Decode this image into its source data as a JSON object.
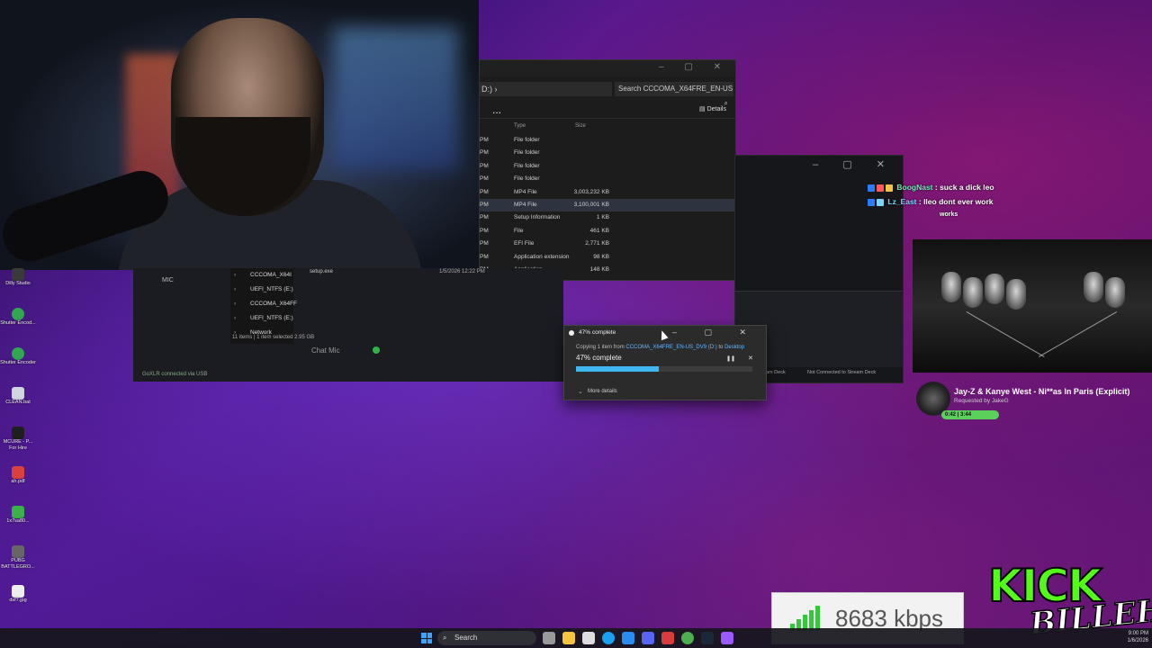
{
  "explorer": {
    "address_suffix": "D:)",
    "search_placeholder": "Search CCCOMA_X64FRE_EN-US",
    "more_glyph": "...",
    "details_label": "Details",
    "columns": {
      "type": "Type",
      "size": "Size"
    },
    "rows": [
      {
        "pm": "PM",
        "type": "File folder",
        "size": ""
      },
      {
        "pm": "PM",
        "type": "File folder",
        "size": ""
      },
      {
        "pm": "PM",
        "type": "File folder",
        "size": ""
      },
      {
        "pm": "PM",
        "type": "File folder",
        "size": ""
      },
      {
        "pm": "PM",
        "type": "MP4 File",
        "size": "3,003,232 KB"
      },
      {
        "pm": "PM",
        "type": "MP4 File",
        "size": "3,100,001 KB"
      },
      {
        "pm": "PM",
        "type": "Setup Information",
        "size": "1 KB"
      },
      {
        "pm": "PM",
        "type": "File",
        "size": "461 KB"
      },
      {
        "pm": "PM",
        "type": "EFI File",
        "size": "2,771 KB"
      },
      {
        "pm": "PM",
        "type": "Application extension",
        "size": "98 KB"
      },
      {
        "pm": "PM",
        "type": "Application",
        "size": "148 KB"
      }
    ]
  },
  "obs": {
    "mic_label": "MIC",
    "tree": [
      {
        "label": "CCCOMA_X64I"
      },
      {
        "label": "UEFI_NTFS (E:)"
      },
      {
        "label": "CCCOMA_X64FF"
      },
      {
        "label": "UEFI_NTFS (E:)"
      },
      {
        "label": "Network"
      }
    ],
    "setup_file": "setup.exe",
    "date": "1/5/2026 12:22 PM",
    "status": "11 items  |  1 item selected  2.95 GB",
    "chat_mic": "Chat Mic",
    "goxlr": "GoXLR connected via USB"
  },
  "streamdeck": {
    "deck_label": "am Deck",
    "status": "Not Connected to Stream Deck"
  },
  "copy_dialog": {
    "title": "47% complete",
    "copying_prefix": "Copying 1 item from ",
    "source": "CCCOMA_X64FRE_EN-US_DV9 (D:)",
    "to": " to ",
    "dest": "Desktop",
    "percent_text": "47% complete",
    "progress": 0.47,
    "more_details": "More details",
    "pause_glyph": "❚❚",
    "cancel_glyph": "✕"
  },
  "chat": {
    "messages": [
      {
        "user": "BoogNast",
        "text": "suck a dick leo",
        "color": "#6ee7b7"
      },
      {
        "user": "Lz_East",
        "text": "lleo dont ever work",
        "color": "#7dd3fc"
      }
    ],
    "overflow_text": "works"
  },
  "now_playing": {
    "song": "Jay-Z & Kanye West - Ni**as In Paris (Explicit)",
    "requested_by": "Requested by JakeG",
    "pill": "0:42  |  3:44"
  },
  "desktop_icons": [
    {
      "label": "Dilly Studio",
      "color": "#3a3a3a"
    },
    {
      "label": "Shutter Encod...",
      "color": "#2fa84f"
    },
    {
      "label": "Shutter Encoder",
      "color": "#2fa84f"
    },
    {
      "label": "CLEAN.bat",
      "color": "#cfd6e0"
    },
    {
      "label": "MCURE - P... For Hire",
      "color": "#1f1f1f"
    },
    {
      "label": "ah.pdf",
      "color": "#d94141"
    },
    {
      "label": "1x7sa80...",
      "color": "#3cb04a"
    },
    {
      "label": "PUBG BATTLEGRO...",
      "color": "#666"
    },
    {
      "label": "dsf7.jpg",
      "color": "#eee"
    }
  ],
  "bitrate": {
    "value": "8683 kbps"
  },
  "kick": {
    "top": "KICK",
    "bottom": "BILLEH"
  },
  "taskbar": {
    "search_label": "Search",
    "clock_time": "9:00 PM",
    "clock_date": "1/6/2026",
    "icons": [
      "#999",
      "#f5c542",
      "#ddd",
      "#1aa0f0",
      "#2a8cf0",
      "#5865f2",
      "#d93c3c",
      "#4caf50",
      "#1b2838",
      "#9b59ff"
    ]
  }
}
